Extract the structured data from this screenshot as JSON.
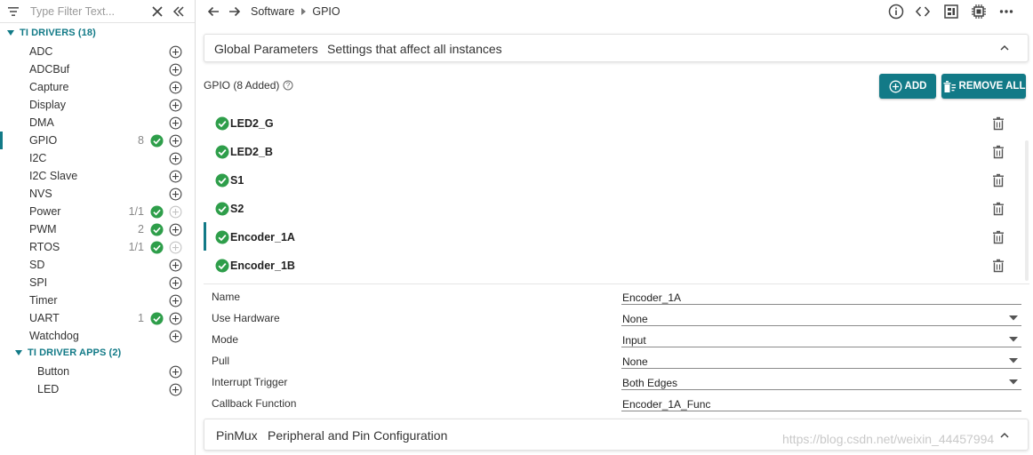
{
  "filter": {
    "placeholder": "Type Filter Text..."
  },
  "sidebar": {
    "group1": "TI DRIVERS (18)",
    "items": [
      {
        "label": "ADC",
        "count": ""
      },
      {
        "label": "ADCBuf",
        "count": ""
      },
      {
        "label": "Capture",
        "count": ""
      },
      {
        "label": "Display",
        "count": ""
      },
      {
        "label": "DMA",
        "count": ""
      },
      {
        "label": "GPIO",
        "count": "8"
      },
      {
        "label": "I2C",
        "count": ""
      },
      {
        "label": "I2C Slave",
        "count": ""
      },
      {
        "label": "NVS",
        "count": ""
      },
      {
        "label": "Power",
        "count": "1/1"
      },
      {
        "label": "PWM",
        "count": "2"
      },
      {
        "label": "RTOS",
        "count": "1/1"
      },
      {
        "label": "SD",
        "count": ""
      },
      {
        "label": "SPI",
        "count": ""
      },
      {
        "label": "Timer",
        "count": ""
      },
      {
        "label": "UART",
        "count": "1"
      },
      {
        "label": "Watchdog",
        "count": ""
      }
    ],
    "group2": "TI DRIVER APPS (2)",
    "apps": [
      {
        "label": "Button"
      },
      {
        "label": "LED"
      }
    ]
  },
  "breadcrumb": {
    "items": [
      "Software",
      "GPIO"
    ]
  },
  "global_params": {
    "title": "Global Parameters",
    "desc": "Settings that affect all instances"
  },
  "gpio": {
    "header": "GPIO (8 Added)",
    "add_label": "ADD",
    "remove_all_label": "REMOVE ALL",
    "instances": [
      "LED2_G",
      "LED2_B",
      "S1",
      "S2",
      "Encoder_1A",
      "Encoder_1B"
    ]
  },
  "properties": [
    {
      "label": "Name",
      "value": "Encoder_1A",
      "dropdown": false
    },
    {
      "label": "Use Hardware",
      "value": "None",
      "dropdown": true
    },
    {
      "label": "Mode",
      "value": "Input",
      "dropdown": true
    },
    {
      "label": "Pull",
      "value": "None",
      "dropdown": true
    },
    {
      "label": "Interrupt Trigger",
      "value": "Both Edges",
      "dropdown": true
    },
    {
      "label": "Callback Function",
      "value": "Encoder_1A_Func",
      "dropdown": false
    }
  ],
  "pinmux": {
    "title": "PinMux",
    "desc": "Peripheral and Pin Configuration"
  },
  "watermark": "https://blog.csdn.net/weixin_44457994",
  "colors": {
    "accent": "#127a87",
    "check": "#2e9e4a"
  }
}
